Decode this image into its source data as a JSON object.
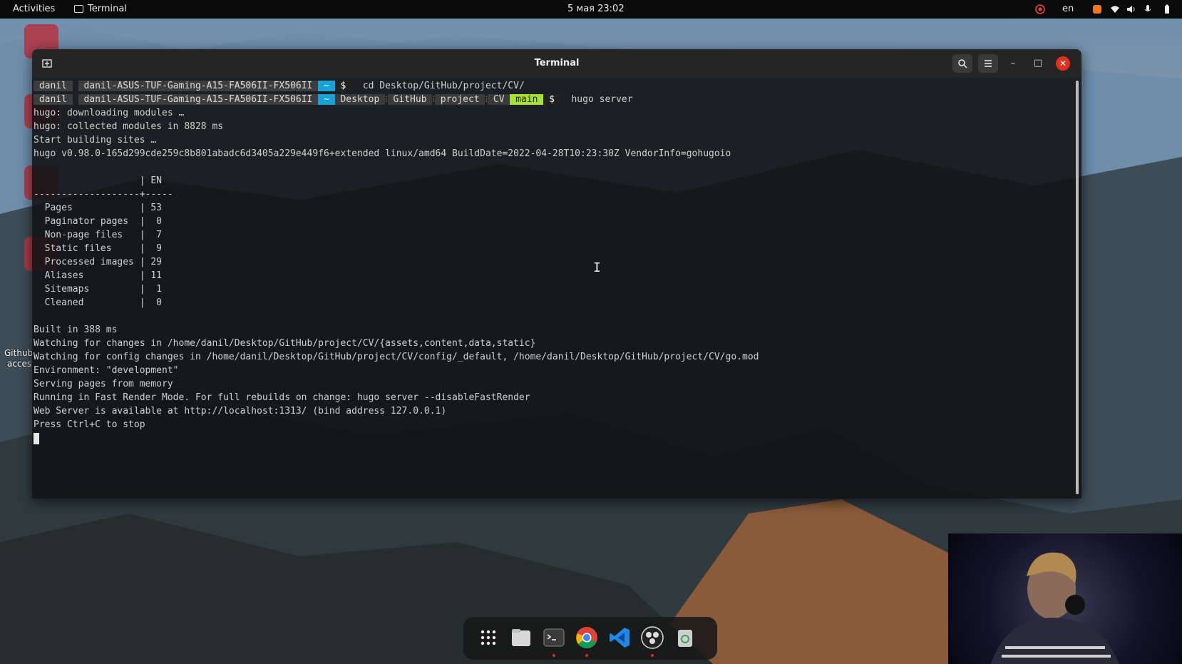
{
  "topbar": {
    "activities": "Activities",
    "app_name": "Terminal",
    "clock": "5 мая 23:02",
    "lang": "en"
  },
  "desktop": {
    "labels": [
      "Github",
      "acces"
    ]
  },
  "window": {
    "title": "Terminal",
    "new_tab_icon": "new-tab-icon",
    "search_icon": "search-icon",
    "menu_icon": "hamburger-menu-icon"
  },
  "prompts": [
    {
      "user": " danil ",
      "host": " danil-ASUS-TUF-Gaming-A15-FA506II-FX506II ",
      "home": " ~ ",
      "dollar": " $ ",
      "command": "  cd Desktop/GitHub/project/CV/"
    },
    {
      "user": " danil ",
      "host": " danil-ASUS-TUF-Gaming-A15-FA506II-FX506II ",
      "home": " ~ ",
      "path": [
        " Desktop ",
        " GitHub ",
        " project ",
        " CV "
      ],
      "branch": " main ",
      "dollar": " $ ",
      "command": "  hugo server"
    }
  ],
  "output": [
    "hugo: downloading modules …",
    "hugo: collected modules in 8828 ms",
    "Start building sites …",
    "hugo v0.98.0-165d299cde259c8b801abadc6d3405a229e449f6+extended linux/amd64 BuildDate=2022-04-28T10:23:30Z VendorInfo=gohugoio",
    "",
    "                   | EN",
    "-------------------+-----",
    "  Pages            | 53",
    "  Paginator pages  |  0",
    "  Non-page files   |  7",
    "  Static files     |  9",
    "  Processed images | 29",
    "  Aliases          | 11",
    "  Sitemaps         |  1",
    "  Cleaned          |  0",
    "",
    "Built in 388 ms",
    "Watching for changes in /home/danil/Desktop/GitHub/project/CV/{assets,content,data,static}",
    "Watching for config changes in /home/danil/Desktop/GitHub/project/CV/config/_default, /home/danil/Desktop/GitHub/project/CV/go.mod",
    "Environment: \"development\"",
    "Serving pages from memory",
    "Running in Fast Render Mode. For full rebuilds on change: hugo server --disableFastRender",
    "Web Server is available at http://localhost:1313/ (bind address 127.0.0.1)",
    "Press Ctrl+C to stop"
  ],
  "dock": {
    "items": [
      "app-grid-icon",
      "files-icon",
      "terminal-icon",
      "chrome-icon",
      "vscode-icon",
      "obs-icon",
      "trash-icon"
    ]
  },
  "colors": {
    "prompt_home": "#19a2d8",
    "prompt_branch": "#a6e22e",
    "close": "#e0301e"
  }
}
